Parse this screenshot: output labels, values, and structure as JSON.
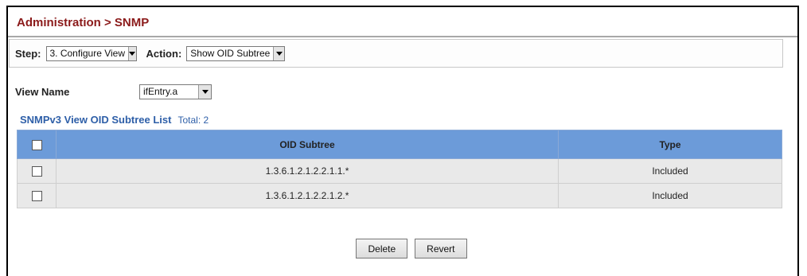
{
  "breadcrumb": "Administration > SNMP",
  "step": {
    "label": "Step:",
    "value": "3. Configure View"
  },
  "action": {
    "label": "Action:",
    "value": "Show OID Subtree"
  },
  "view_name": {
    "label": "View Name",
    "value": "ifEntry.a"
  },
  "list": {
    "title": "SNMPv3 View OID Subtree List",
    "total": "Total: 2",
    "headers": {
      "oid": "OID Subtree",
      "type": "Type"
    },
    "rows": [
      {
        "oid": "1.3.6.1.2.1.2.2.1.1.*",
        "type": "Included"
      },
      {
        "oid": "1.3.6.1.2.1.2.2.1.2.*",
        "type": "Included"
      }
    ]
  },
  "buttons": {
    "delete": "Delete",
    "revert": "Revert"
  },
  "colors": {
    "header_text": "#8b1a1a",
    "table_header": "#6c9bd9",
    "section_title": "#2e5fa8"
  }
}
